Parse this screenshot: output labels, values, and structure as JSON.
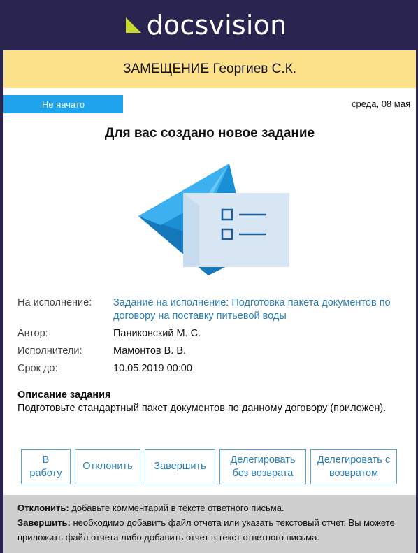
{
  "brand": {
    "name": "docsvision",
    "mark_color": "#c7d82f"
  },
  "banner": {
    "text": "ЗАМЕЩЕНИЕ Георгиев С.К.",
    "color": "#fde08a"
  },
  "status": {
    "label": "Не начато",
    "color": "#1fa3ec"
  },
  "date": "среда, 08 мая",
  "title": "Для вас создано новое задание",
  "illustration": {
    "icon": "task-envelope-icon"
  },
  "details": [
    {
      "label": "На исполнение:",
      "value": "Задание на исполнение: Подготовка пакета документов по договору на поставку питьевой воды",
      "link": true
    },
    {
      "label": "Автор:",
      "value": "Паниковский М. С.",
      "link": false
    },
    {
      "label": "Исполнители:",
      "value": "Мамонтов В. В.",
      "link": false
    },
    {
      "label": "Срок до:",
      "value": "10.05.2019 00:00",
      "link": false
    }
  ],
  "description": {
    "title": "Описание задания",
    "text": "Подготовьте стандартный пакет документов по данному договору (приложен)."
  },
  "actions": [
    {
      "label": "В работу"
    },
    {
      "label": "Отклонить"
    },
    {
      "label": "Завершить"
    },
    {
      "label": "Делегировать без возврата"
    },
    {
      "label": "Делегировать с возвратом"
    }
  ],
  "footer": {
    "reject": {
      "term": "Отклонить:",
      "text": " добавьте комментарий в тексте ответного письма."
    },
    "complete": {
      "term": "Завершить:",
      "text": " необходимо добавить файл отчета или указать текстовый отчет. Вы можете приложить файл отчета либо добавить отчет в текст ответного письма."
    }
  }
}
